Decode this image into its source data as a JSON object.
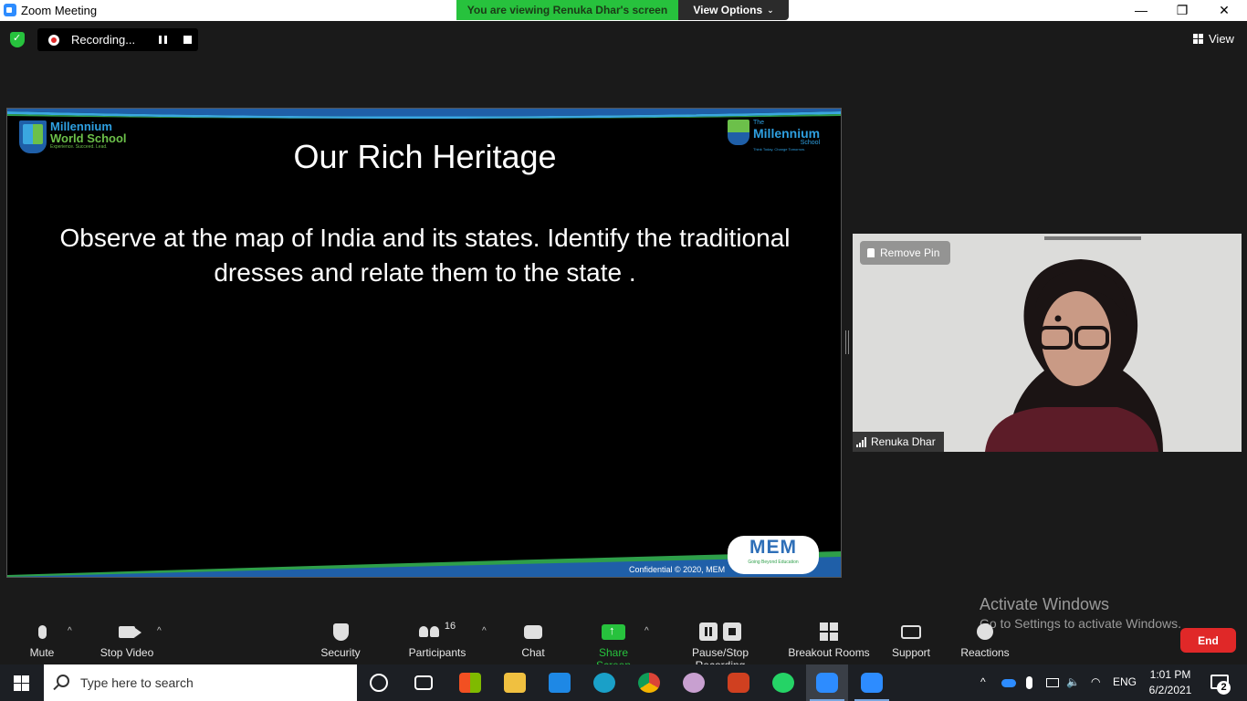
{
  "window": {
    "title": "Zoom Meeting",
    "viewing_banner": "You are viewing Renuka Dhar's screen",
    "view_options": "View Options",
    "minimize": "—",
    "maximize": "❐",
    "close": "✕"
  },
  "recording": {
    "label": "Recording..."
  },
  "view": {
    "label": "View"
  },
  "slide": {
    "title": "Our Rich Heritage",
    "body": "Observe  at the map of India and its states. Identify the traditional dresses and relate them to the state .",
    "logo_left_line1": "Millennium",
    "logo_left_line2": "World School",
    "logo_left_tagline": "Experience. Succeed. Lead.",
    "logo_right_line1": "The",
    "logo_right_line2": "Millennium",
    "logo_right_line3": "School",
    "logo_right_tagline": "Think Today. Change Tomorrow.",
    "mem_logo": "MEM",
    "mem_tagline": "Going Beyond Education",
    "confidential": "Confidential © 2020, MEM"
  },
  "video": {
    "remove_pin": "Remove Pin",
    "participant_name": "Renuka Dhar"
  },
  "activate_windows": {
    "line1": "Activate Windows",
    "line2": "Go to Settings to activate Windows."
  },
  "toolbar": {
    "mute": "Mute",
    "stop_video": "Stop Video",
    "security": "Security",
    "participants": "Participants",
    "participants_count": "16",
    "chat": "Chat",
    "share_screen": "Share Screen",
    "pause_stop_recording": "Pause/Stop Recording",
    "breakout_rooms": "Breakout Rooms",
    "support": "Support",
    "reactions": "Reactions",
    "end": "End"
  },
  "taskbar": {
    "search_placeholder": "Type here to search",
    "language": "ENG",
    "time": "1:01 PM",
    "date": "6/2/2021",
    "notification_count": "2"
  },
  "colors": {
    "zoom_blue": "#2d8cff",
    "share_green": "#27c23d",
    "end_red": "#e02828"
  }
}
